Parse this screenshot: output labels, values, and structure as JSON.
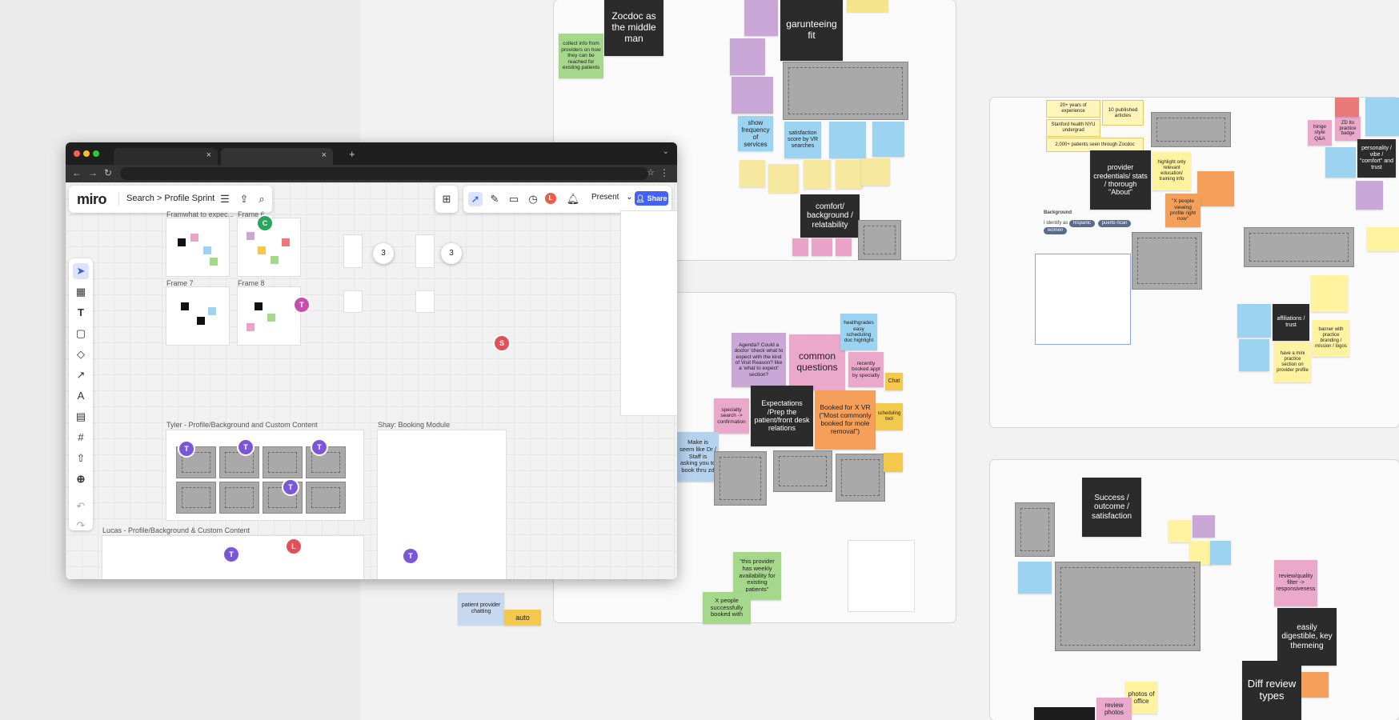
{
  "browser": {
    "tabs": [
      {
        "close": "×"
      },
      {
        "close": "×"
      }
    ],
    "new_tab": "+",
    "nav": {
      "back": "←",
      "forward": "→",
      "reload": "↻"
    }
  },
  "miro": {
    "logo": "miro",
    "board": {
      "breadcrumb": "Search > Profile Sprint"
    },
    "present_label": "Present",
    "share_label": "Share",
    "user_initial": "L",
    "tools": [
      "select",
      "templates",
      "text",
      "sticky",
      "shapes",
      "line",
      "pen",
      "comment",
      "frame",
      "upload",
      "more",
      "undo",
      "redo"
    ],
    "frames": {
      "f1": "Framwhat to expec...",
      "f2": "Frame 6",
      "f3": "Frame 7",
      "f4": "Frame 8",
      "tyler": "Tyler - Profile/Background and Custom Content",
      "shay": "Shay: Booking Module",
      "lucas": "Lucas - Profile/Background & Custom Content"
    },
    "counts": [
      "3",
      "3"
    ],
    "avatars": [
      {
        "initial": "C",
        "color": "#2aa55b"
      },
      {
        "initial": "T",
        "color": "#c44fb0"
      },
      {
        "initial": "S",
        "color": "#e0505a"
      },
      {
        "initial": "T",
        "color": "#7b56d6"
      },
      {
        "initial": "L",
        "color": "#e0505a"
      }
    ]
  },
  "notes": {
    "zocdoc": "Zocdoc as the middle man",
    "collect": "collect info from providers on how they can be reached for existing patients",
    "garunteeing": "garunteeing fit",
    "show_freq": "show frequency of services",
    "satisfaction": "satisfaction score by VR searches",
    "comfort": "comfort/ background / relatability",
    "common": "common questions",
    "agenda": "Agenda? Could a doctor 'check what to expect with the kind of Visit Reason? like a 'what to expect' section?",
    "expectations": "Expectations /Prep the patient/front desk relations",
    "booked": "Booked for X VR (\"Most commonly booked for mole removal\")",
    "healthgrades": "healthgrades easy scheduling doc highlight",
    "recently": "recently booked appt by specialty",
    "chat": "Chat",
    "scheduling": "scheduling tool",
    "specialty": "specialty search -> confirmation",
    "make_sure": "Make is seem like Dr / Staff is asking you to book thru zd",
    "availability": "\"this provider has weekly availability for existing patients\"",
    "x_people": "X people successfully booked with",
    "patient_provider": "patient provider chatting",
    "auto": "auto",
    "credentials": "provider credentials/ stats / thorough \"About\"",
    "experience": "20+ years of experience",
    "published": "10 published articles",
    "stanford": "Stanford health NYU undergrad",
    "patients_seen": "2,000+ patients seen through Zocdoc",
    "highlight": "highlight only relevant education/ training info",
    "x_people_viewing": "\"X people viewing profile right now\"",
    "hinge": "hinge style Q&A",
    "zd_badge": "ZD Ito practice badge",
    "personality": "personality / vibe / \"comfort\" and trust",
    "affiliations": "affiliations / trust",
    "mini_practice": "have a mini practice section on provider profile",
    "banner": "banner with practice branding / mission / logos",
    "success": "Success / outcome / satisfaction",
    "reviewquality": "review/quality filter -> responsiveness",
    "easily": "easily digestible, key themeing",
    "diff_review": "Diff review types",
    "photos": "photos of office",
    "review_photos": "review photos",
    "background_label": "Background",
    "identify": "I identify as",
    "tags": [
      "hispanic",
      "puerto rican",
      "women"
    ]
  }
}
